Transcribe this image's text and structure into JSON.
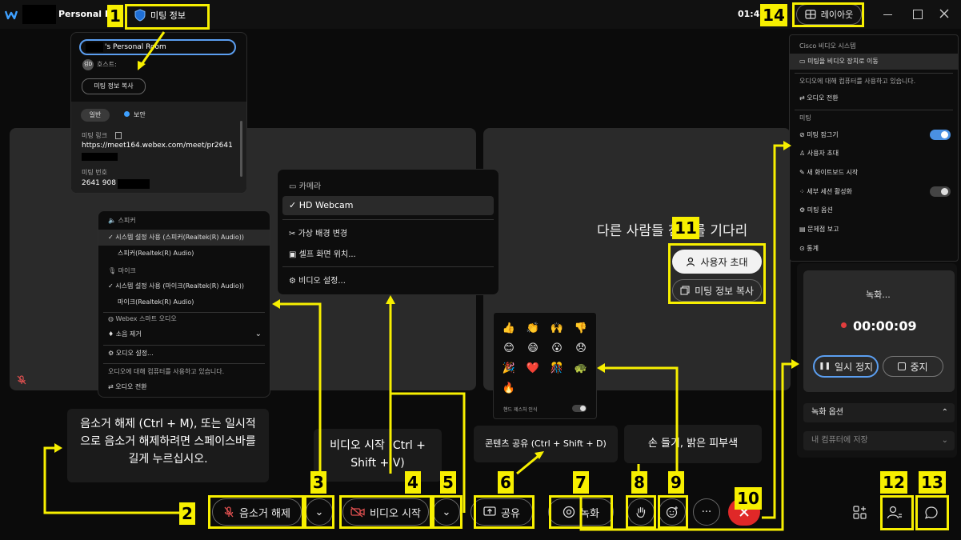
{
  "titlebar": {
    "room_name": "Personal Ro",
    "meeting_info_label": "미팅 정보",
    "time": "01:45",
    "layout_label": "레이아웃"
  },
  "meeting_info": {
    "room_field": "'s Personal Room",
    "host_initials": "김D",
    "host_label": "호스트:",
    "copy_button": "미팅 정보 복사",
    "tab_general": "일반",
    "tab_security": "보안",
    "link_label": "미팅 링크",
    "link_value": "https://meet164.webex.com/meet/pr2641",
    "number_label": "미팅 번호",
    "number_value": "2641 908"
  },
  "audio_menu": {
    "speaker_header": "스피커",
    "speaker_opt1": "시스템 설정 사용 (스피커(Realtek(R) Audio))",
    "speaker_opt2": "스피커(Realtek(R) Audio)",
    "mic_header": "마이크",
    "mic_opt1": "시스템 설정 사용 (마이크(Realtek(R) Audio))",
    "mic_opt2": "마이크(Realtek(R) Audio)",
    "smart_header": "Webex 스마트 오디오",
    "noise_label": "소음 제거",
    "audio_settings": "오디오 설정...",
    "using_computer": "오디오에 대해 컴퓨터를 사용하고 있습니다.",
    "switch_audio": "오디오 전환"
  },
  "video_menu": {
    "camera_header": "카메라",
    "webcam": "HD Webcam",
    "virtual_bg": "가상 배경 변경",
    "self_view": "셀프 화면 위치...",
    "video_settings": "비디오 설정..."
  },
  "stage": {
    "waiting_text": "다른 사람들 참여를 기다리",
    "invite_button": "사용자 초대",
    "copy_info_button": "미팅 정보 복사"
  },
  "reactions": {
    "emojis": [
      "👍",
      "👏",
      "🙌",
      "👎",
      "😊",
      "😄",
      "😮",
      "😞",
      "🎉",
      "❤️",
      "🎊",
      "🐢",
      "🔥"
    ],
    "gesture_label": "핸드 제스처 인식"
  },
  "more_menu": {
    "cisco_header": "Cisco 비디오 시스템",
    "move_to_device": "미팅을 비디오 장치로 이동",
    "using_computer": "오디오에 대해 컴퓨터를 사용하고 있습니다.",
    "switch_audio": "오디오 전환",
    "meeting_header": "미팅",
    "lock_meeting": "미팅 잠그기",
    "invite_users": "사용자 초대",
    "whiteboard": "새 화이트보드 시작",
    "breakout": "세부 세션 활성화",
    "meeting_options": "미팅 옵션",
    "report_problem": "문제점 보고",
    "stats": "통계"
  },
  "recording": {
    "title": "녹화...",
    "timer": "00:00:09",
    "pause": "일시 정지",
    "stop": "중지",
    "options": "녹화 옵션",
    "save_to": "내 컴퓨터에 저장"
  },
  "tooltips": {
    "unmute": "음소거 해제 (Ctrl + M), 또는 일시적으로 음소거 해제하려면 스페이스바를 길게 누르십시오.",
    "start_video": "비디오 시작 (Ctrl + Shift + V)",
    "share": "콘텐츠 공유 (Ctrl + Shift + D)",
    "raise_hand": "손 들기, 밝은 피부색"
  },
  "controls": {
    "unmute": "음소거 해제",
    "start_video": "비디오 시작",
    "share": "공유",
    "record": "녹화",
    "more": "···"
  },
  "callouts": [
    "1",
    "2",
    "3",
    "4",
    "5",
    "6",
    "7",
    "8",
    "9",
    "10",
    "11",
    "12",
    "13",
    "14"
  ],
  "colors": {
    "accent": "#f7ef00",
    "end": "#e02828",
    "toggle_on": "#4a90e2",
    "record_dot": "#e23d3d"
  }
}
